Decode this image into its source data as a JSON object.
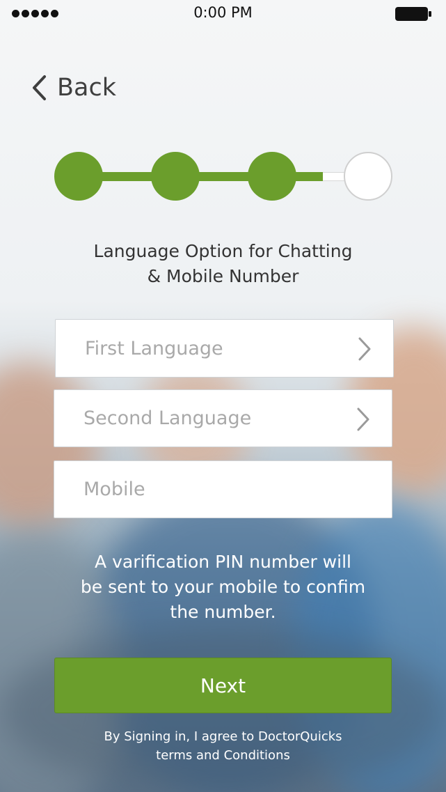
{
  "status_bar": {
    "time": "0:00 PM"
  },
  "nav": {
    "back_label": "Back"
  },
  "progress": {
    "total_steps": 4,
    "completed_steps": 3,
    "connector_fill": 0.55,
    "accent": "#6b9e2c"
  },
  "page": {
    "title_line1": "Language Option for Chatting",
    "title_line2": "& Mobile Number"
  },
  "form": {
    "first_language": {
      "placeholder": "First Language"
    },
    "second_language": {
      "placeholder": "Second Language"
    },
    "mobile": {
      "placeholder": "Mobile"
    }
  },
  "hint": {
    "line1": "A varification PIN number will",
    "line2": "be sent to your mobile to confim",
    "line3": "the number."
  },
  "actions": {
    "next_label": "Next"
  },
  "footer": {
    "line1": "By Signing in, I agree to DoctorQuicks",
    "line2": "terms and Conditions"
  }
}
